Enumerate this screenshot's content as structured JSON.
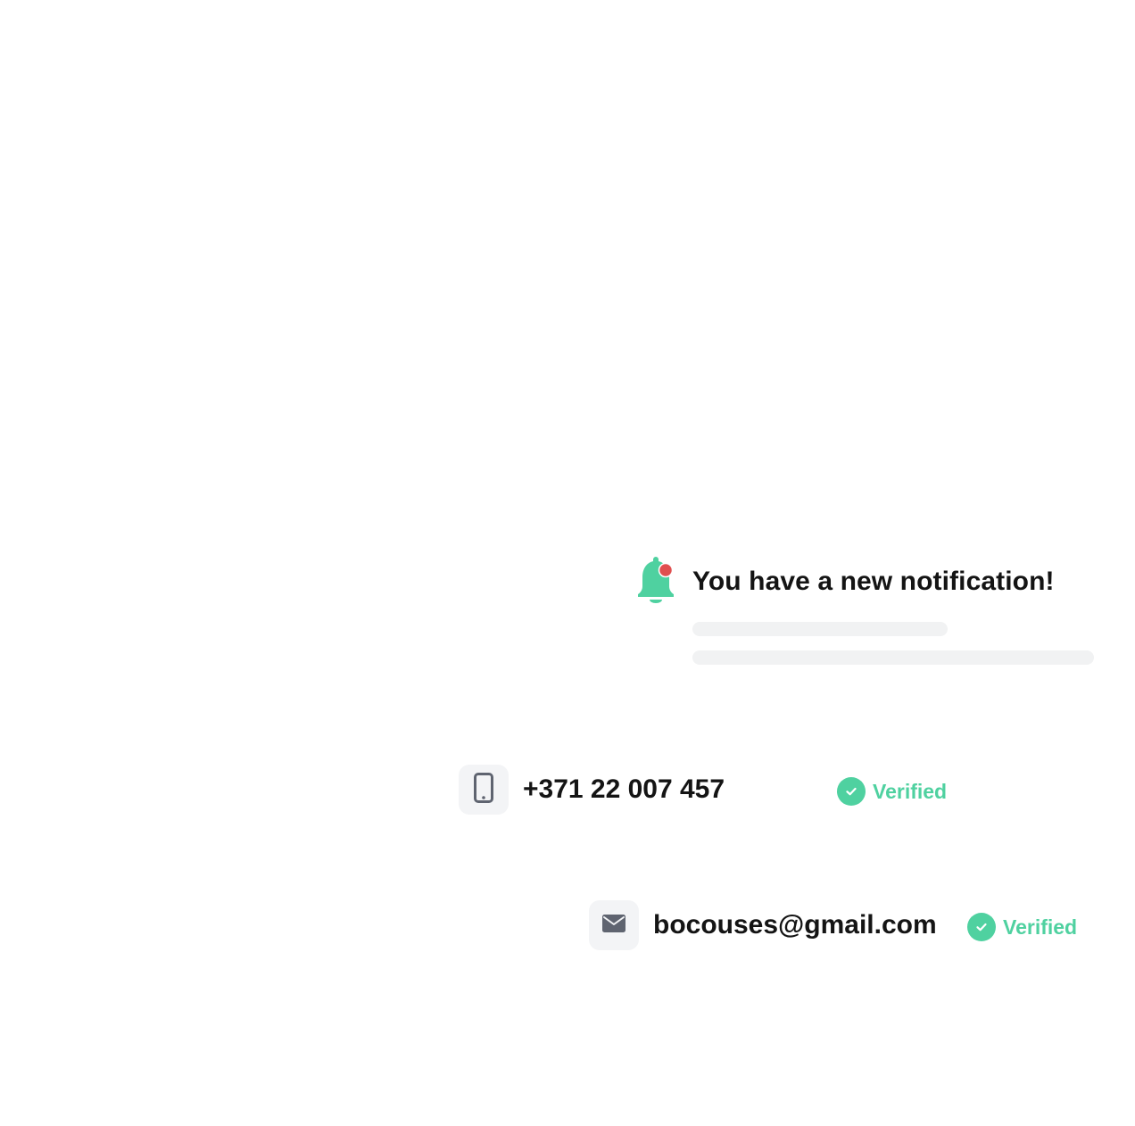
{
  "colors": {
    "accent_green": "#4fd1a0",
    "notification_dot": "#e04f4f",
    "icon_gray": "#5f6470",
    "tile_bg": "#f3f4f6",
    "skeleton": "#f1f2f3",
    "text_dark": "#141414"
  },
  "notification": {
    "icon": "bell-icon",
    "title": "You have a new notification!"
  },
  "contacts": {
    "phone": {
      "icon": "mobile-phone-icon",
      "value": "+371 22 007 457",
      "status": "Verified",
      "status_icon": "check-circle-icon"
    },
    "email": {
      "icon": "envelope-icon",
      "value": "bocouses@gmail.com",
      "status": "Verified",
      "status_icon": "check-circle-icon"
    }
  }
}
